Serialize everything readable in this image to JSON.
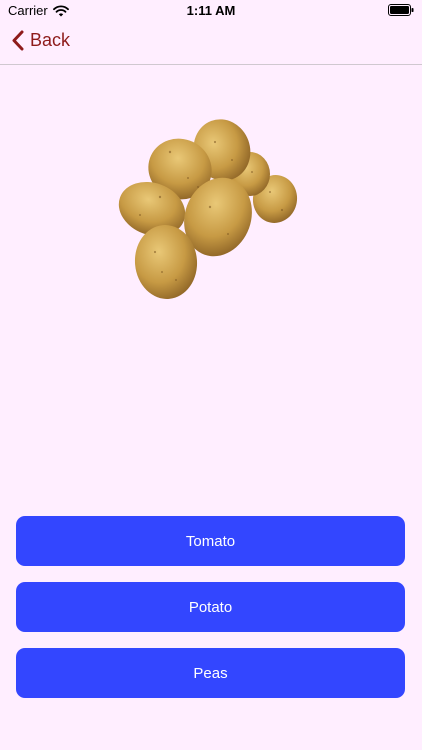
{
  "status_bar": {
    "carrier": "Carrier",
    "time": "1:11 AM",
    "wifi_icon": "wifi-icon",
    "battery_icon": "battery-full-icon"
  },
  "nav": {
    "back_label": "Back",
    "back_icon": "chevron-left-icon",
    "tint_color": "#8E1B1B"
  },
  "quiz": {
    "image_subject": "potatoes",
    "options": [
      "Tomato",
      "Potato",
      "Peas"
    ],
    "button_color": "#3346FF"
  },
  "background_color": "#FFEEFF"
}
